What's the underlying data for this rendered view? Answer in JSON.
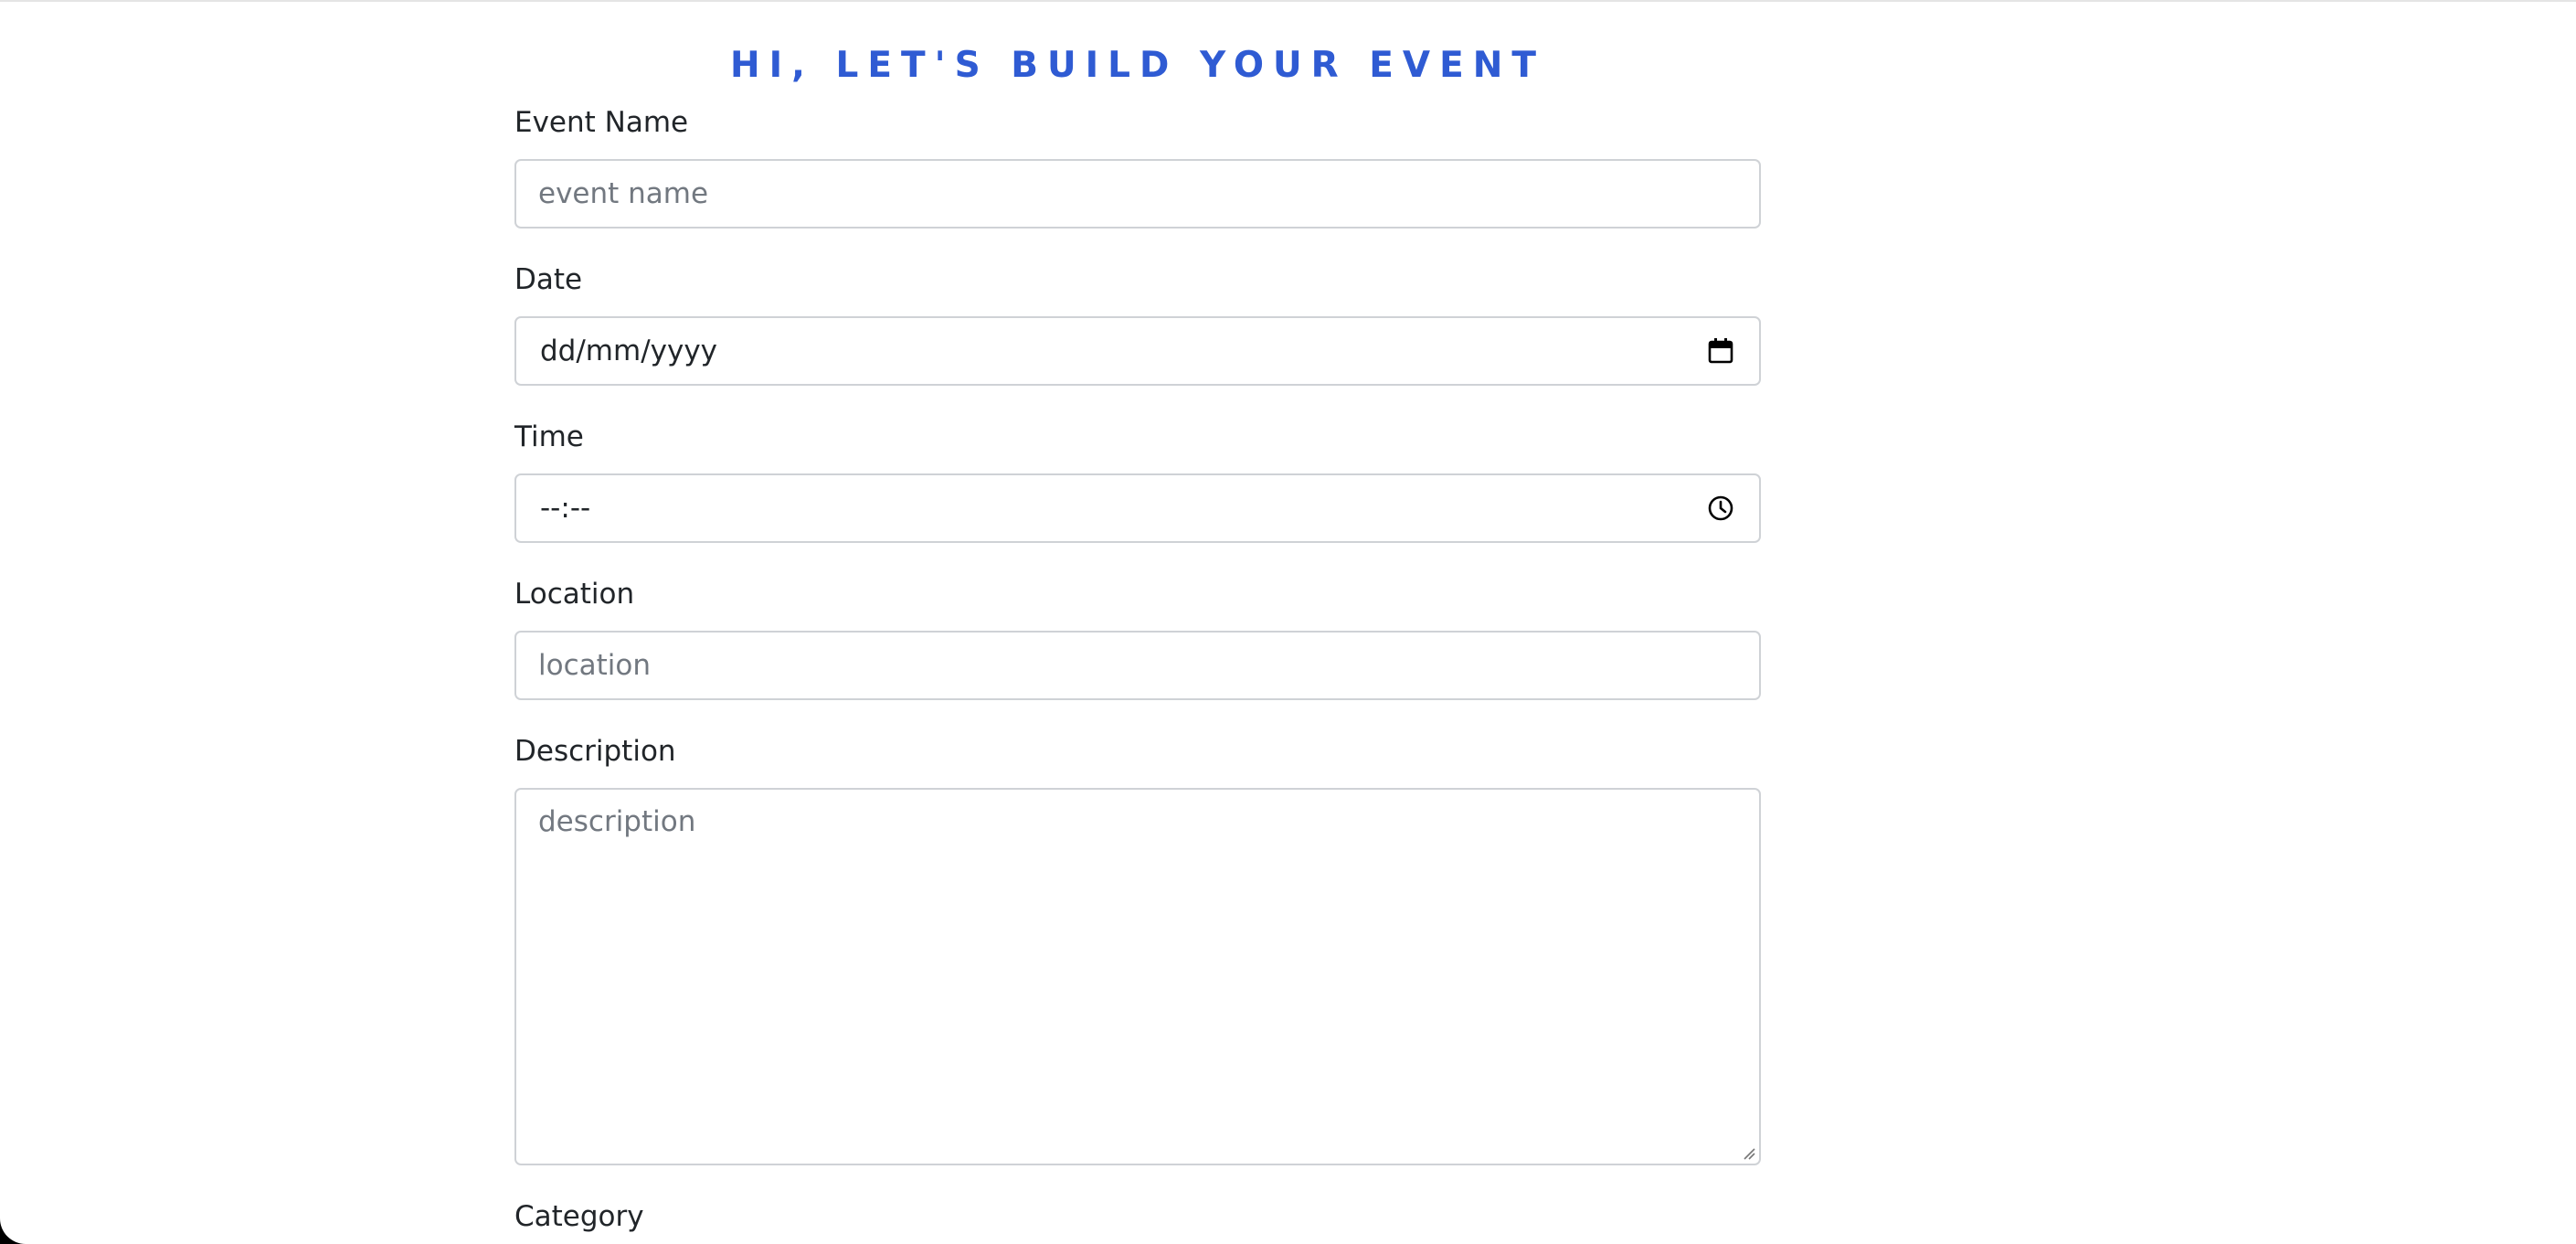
{
  "heading": "HI, LET'S BUILD YOUR EVENT",
  "form": {
    "event_name": {
      "label": "Event Name",
      "placeholder": "event name"
    },
    "date": {
      "label": "Date",
      "value": "dd/mm/yyyy",
      "icon": "calendar-icon"
    },
    "time": {
      "label": "Time",
      "value": "--:--",
      "icon": "clock-icon"
    },
    "location": {
      "label": "Location",
      "placeholder": "location"
    },
    "description": {
      "label": "Description",
      "placeholder": "description"
    },
    "category": {
      "label": "Category"
    }
  },
  "colors": {
    "heading": "#2f5bd3",
    "label": "#212529",
    "placeholder": "#727880",
    "border": "#cfd2d6"
  }
}
